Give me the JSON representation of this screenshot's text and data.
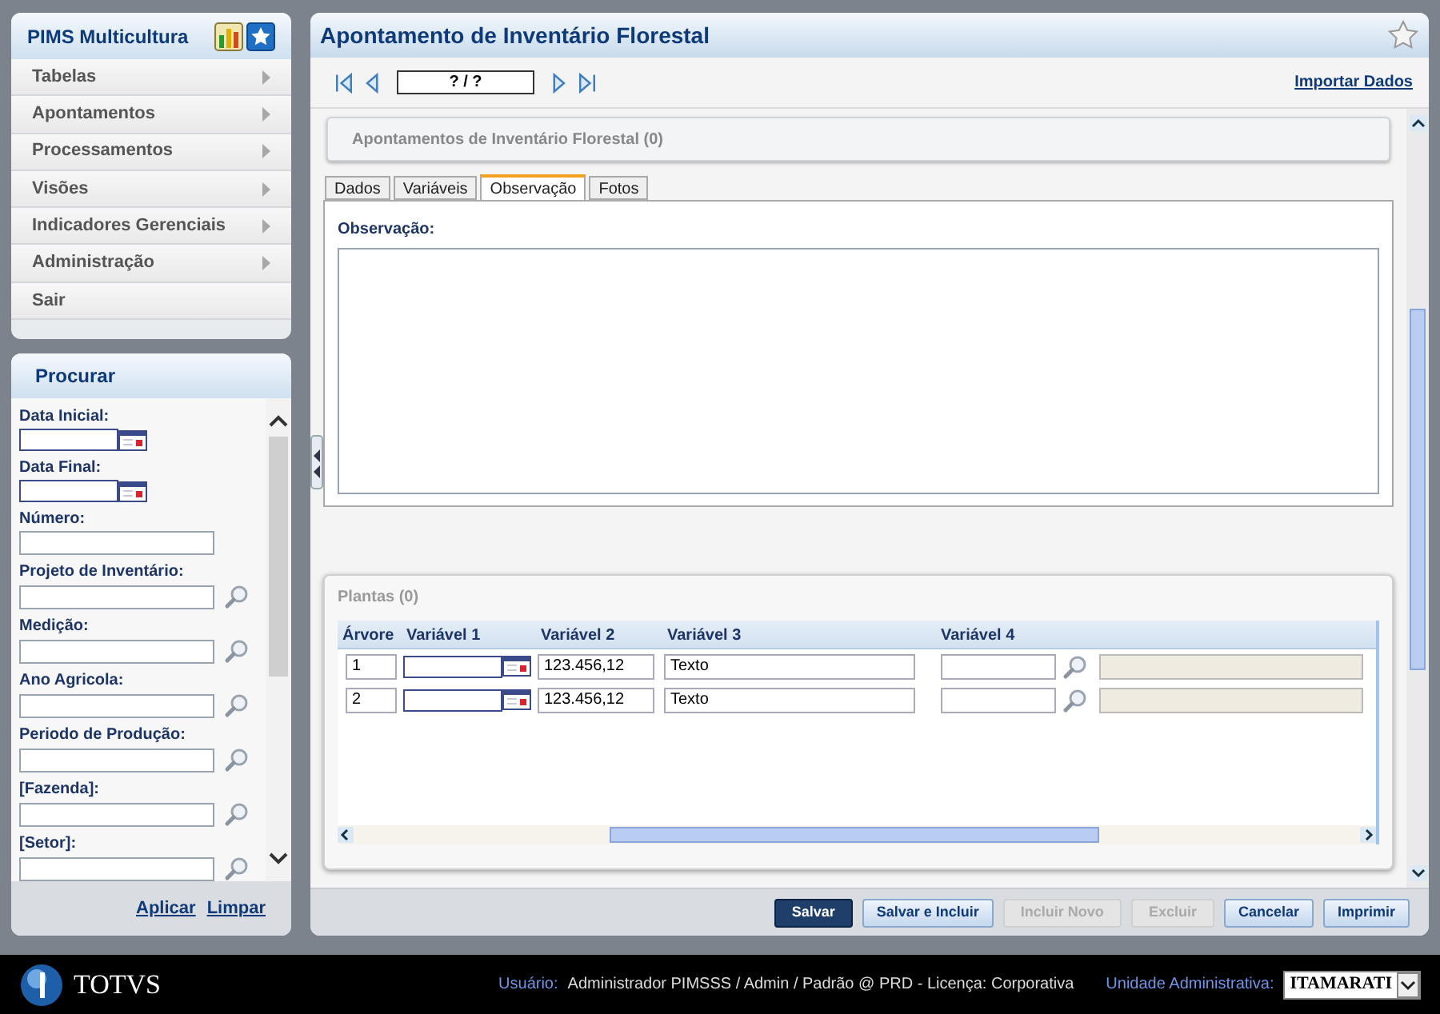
{
  "menu": {
    "title": "PIMS Multicultura",
    "items": [
      {
        "label": "Tabelas",
        "submenu": true
      },
      {
        "label": "Apontamentos",
        "submenu": true
      },
      {
        "label": "Processamentos",
        "submenu": true
      },
      {
        "label": "Visões",
        "submenu": true
      },
      {
        "label": "Indicadores Gerenciais",
        "submenu": true
      },
      {
        "label": "Administração",
        "submenu": true
      },
      {
        "label": "Sair",
        "submenu": false
      }
    ]
  },
  "search": {
    "title": "Procurar",
    "fields": [
      {
        "label": "Data Inicial:",
        "kind": "date"
      },
      {
        "label": "Data Final:",
        "kind": "date"
      },
      {
        "label": "Número:",
        "kind": "text"
      },
      {
        "label": "Projeto de Inventário:",
        "kind": "lookup"
      },
      {
        "label": "Medição:",
        "kind": "lookup"
      },
      {
        "label": "Ano Agricola:",
        "kind": "lookup"
      },
      {
        "label": "Periodo de Produção:",
        "kind": "lookup"
      },
      {
        "label": "[Fazenda]:",
        "kind": "lookup"
      },
      {
        "label": "[Setor]:",
        "kind": "lookup"
      }
    ],
    "links": [
      "Aplicar",
      "Limpar"
    ]
  },
  "main": {
    "title": "Apontamento de Inventário Florestal",
    "record": "? / ?",
    "import_link": "Importar Dados",
    "section_title": "Apontamentos de Inventário Florestal (0)",
    "tabs": [
      {
        "label": "Dados",
        "selected": false
      },
      {
        "label": "Variáveis",
        "selected": false
      },
      {
        "label": "Observação",
        "selected": true
      },
      {
        "label": "Fotos",
        "selected": false
      }
    ],
    "observation_label": "Observação:",
    "plants": {
      "title": "Plantas (0)",
      "columns": [
        "Árvore",
        "Variável 1",
        "Variável 2",
        "Variável 3",
        "Variável 4"
      ],
      "rows": [
        {
          "arvore": "1",
          "variavel_2": "123.456,12",
          "variavel_3": "Texto"
        },
        {
          "arvore": "2",
          "variavel_2": "123.456,12",
          "variavel_3": "Texto"
        }
      ]
    },
    "buttons": [
      {
        "label": "Salvar",
        "primary": true,
        "disabled": false
      },
      {
        "label": "Salvar e Incluir",
        "primary": false,
        "disabled": false
      },
      {
        "label": "Incluir Novo",
        "primary": false,
        "disabled": true
      },
      {
        "label": "Excluir",
        "primary": false,
        "disabled": true
      },
      {
        "label": "Cancelar",
        "primary": false,
        "disabled": false
      },
      {
        "label": "Imprimir",
        "primary": false,
        "disabled": false
      }
    ]
  },
  "footer": {
    "brand": "TOTVS",
    "user_label": "Usuário:",
    "user_info": "Administrador PIMSSS / Admin / Padrão @ PRD - Licença: Corporativa",
    "unit_label": "Unidade Administrativa:",
    "unit_value": "ITAMARATI"
  }
}
